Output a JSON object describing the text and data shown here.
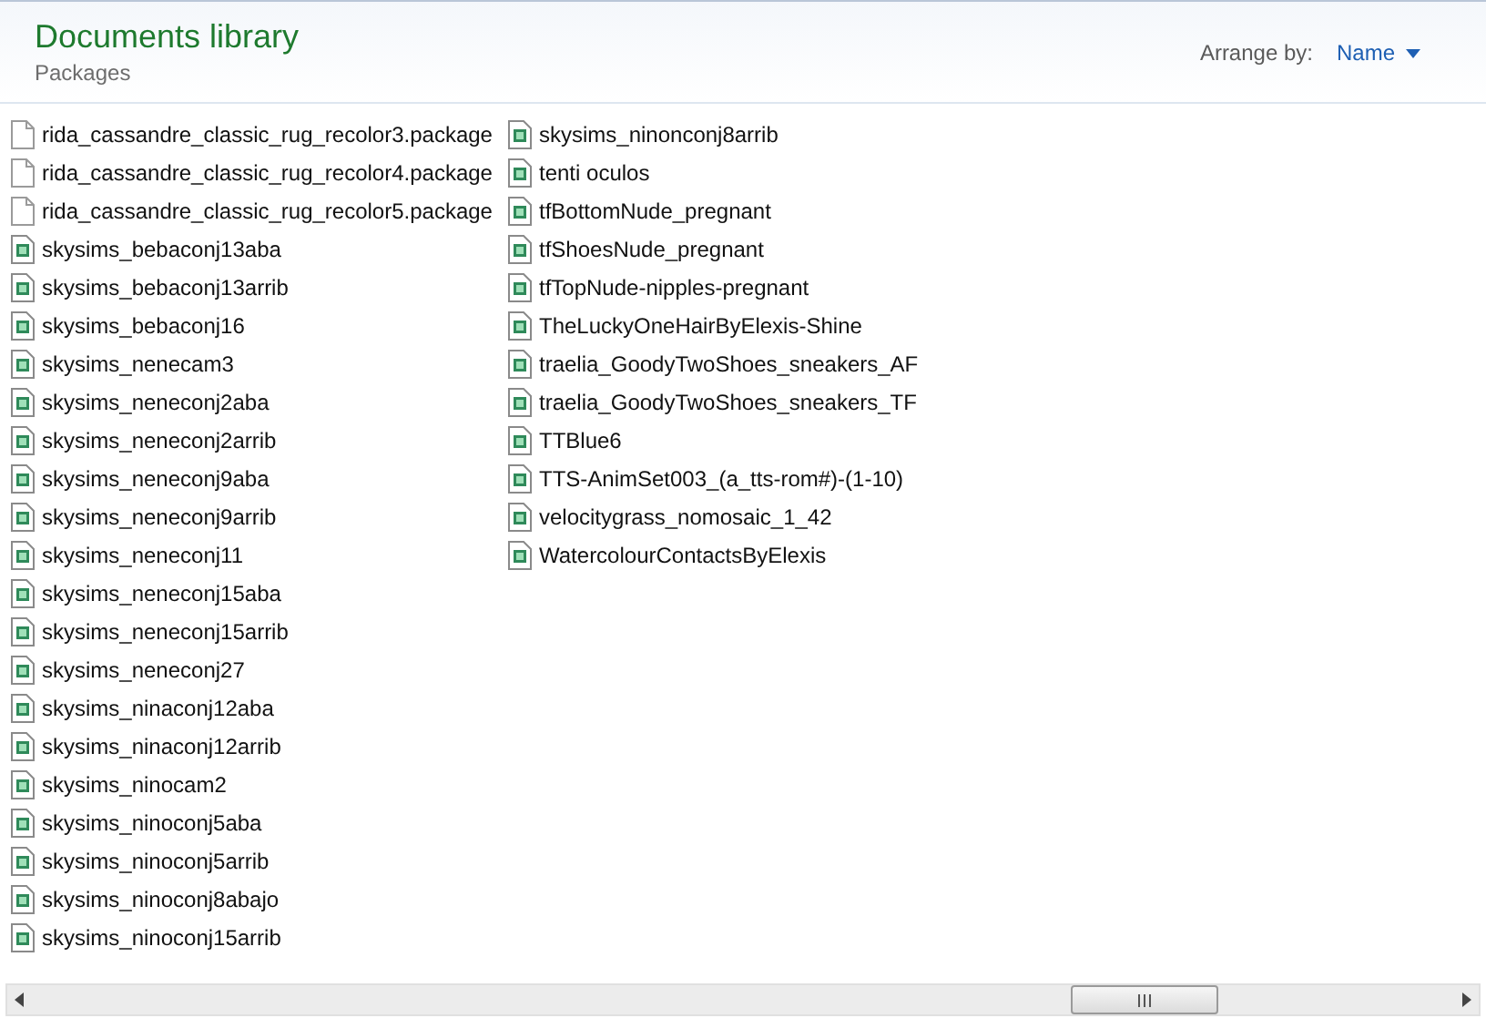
{
  "header": {
    "title": "Documents library",
    "subtitle": "Packages",
    "arrange_label": "Arrange by:",
    "arrange_value": "Name"
  },
  "files": [
    {
      "name": "rida_cassandre_classic_rug_recolor3.package",
      "kind": "plain"
    },
    {
      "name": "rida_cassandre_classic_rug_recolor4.package",
      "kind": "plain"
    },
    {
      "name": "rida_cassandre_classic_rug_recolor5.package",
      "kind": "plain"
    },
    {
      "name": "skysims_bebaconj13aba",
      "kind": "package"
    },
    {
      "name": "skysims_bebaconj13arrib",
      "kind": "package"
    },
    {
      "name": "skysims_bebaconj16",
      "kind": "package"
    },
    {
      "name": "skysims_nenecam3",
      "kind": "package"
    },
    {
      "name": "skysims_neneconj2aba",
      "kind": "package"
    },
    {
      "name": "skysims_neneconj2arrib",
      "kind": "package"
    },
    {
      "name": "skysims_neneconj9aba",
      "kind": "package"
    },
    {
      "name": "skysims_neneconj9arrib",
      "kind": "package"
    },
    {
      "name": "skysims_neneconj11",
      "kind": "package"
    },
    {
      "name": "skysims_neneconj15aba",
      "kind": "package"
    },
    {
      "name": "skysims_neneconj15arrib",
      "kind": "package"
    },
    {
      "name": "skysims_neneconj27",
      "kind": "package"
    },
    {
      "name": "skysims_ninaconj12aba",
      "kind": "package"
    },
    {
      "name": "skysims_ninaconj12arrib",
      "kind": "package"
    },
    {
      "name": "skysims_ninocam2",
      "kind": "package"
    },
    {
      "name": "skysims_ninoconj5aba",
      "kind": "package"
    },
    {
      "name": "skysims_ninoconj5arrib",
      "kind": "package"
    },
    {
      "name": "skysims_ninoconj8abajo",
      "kind": "package"
    },
    {
      "name": "skysims_ninoconj15arrib",
      "kind": "package"
    },
    {
      "name": "skysims_ninonconj8arrib",
      "kind": "package"
    },
    {
      "name": "tenti oculos",
      "kind": "package"
    },
    {
      "name": "tfBottomNude_pregnant",
      "kind": "package"
    },
    {
      "name": "tfShoesNude_pregnant",
      "kind": "package"
    },
    {
      "name": "tfTopNude-nipples-pregnant",
      "kind": "package"
    },
    {
      "name": "TheLuckyOneHairByElexis-Shine",
      "kind": "package"
    },
    {
      "name": "traelia_GoodyTwoShoes_sneakers_AF",
      "kind": "package"
    },
    {
      "name": "traelia_GoodyTwoShoes_sneakers_TF",
      "kind": "package"
    },
    {
      "name": "TTBlue6",
      "kind": "package"
    },
    {
      "name": "TTS-AnimSet003_(a_tts-rom#)-(1-10)",
      "kind": "package"
    },
    {
      "name": "velocitygrass_nomosaic_1_42",
      "kind": "package"
    },
    {
      "name": "WatercolourContactsByElexis",
      "kind": "package"
    }
  ]
}
